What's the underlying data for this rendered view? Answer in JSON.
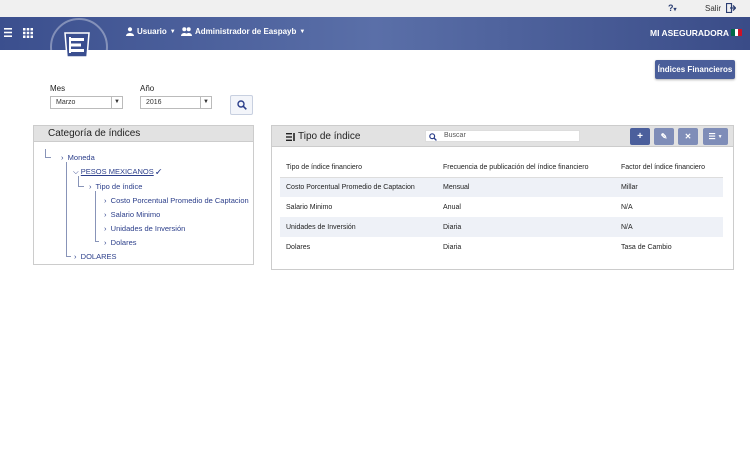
{
  "topbar": {
    "help_icon": "help-icon",
    "salir": "Salir"
  },
  "nav": {
    "usuario": "Usuario",
    "admin": "Administrador de Easpayb",
    "company": "MI ASEGURADORA",
    "flag_colors": [
      "#006847",
      "#ffffff",
      "#ce1126"
    ]
  },
  "indices_button": "Índices Financieros",
  "filters": {
    "mes_label": "Mes",
    "mes_value": "Marzo",
    "anio_label": "Año",
    "anio_value": "2016"
  },
  "category_panel": {
    "title": "Categoría de índices",
    "tree": {
      "root": "Moneda",
      "pesos": "PESOS MEXICANOS",
      "tipo": "Tipo de índice",
      "children": [
        "Costo Porcentual Promedio de Captacion",
        "Salario Minimo",
        "Unidades de Inversión",
        "Dolares"
      ],
      "dolares": "DOLARES"
    }
  },
  "type_panel": {
    "title": "Tipo de índice",
    "search_placeholder": "Buscar",
    "columns": [
      "Tipo de índice financiero",
      "Frecuencia de publicación del índice financiero",
      "Factor del índice financiero"
    ],
    "rows": [
      [
        "Costo Porcentual Promedio de Captacion",
        "Mensual",
        "Millar"
      ],
      [
        "Salario Minimo",
        "Anual",
        "N/A"
      ],
      [
        "Unidades de Inversión",
        "Diaria",
        "N/A"
      ],
      [
        "Dolares",
        "Diaria",
        "Tasa de Cambio"
      ]
    ]
  }
}
